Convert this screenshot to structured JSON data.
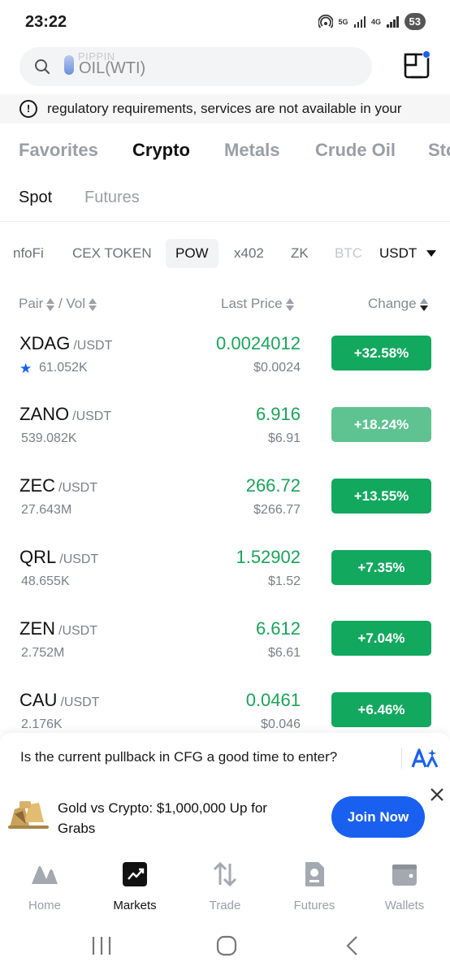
{
  "status_bar": {
    "time": "23:22",
    "net1": "5G",
    "net2": "4G",
    "battery": "53",
    "icons": [
      "hotspot-icon",
      "signal-icon",
      "battery-icon"
    ]
  },
  "search": {
    "ghost_text": "PIPPIN",
    "text": "OIL(WTI)",
    "icons": [
      "search-icon",
      "scan-icon"
    ]
  },
  "notice": {
    "icon": "!",
    "text": "regulatory requirements, services are not available in your"
  },
  "category_tabs": [
    {
      "label": "Favorites"
    },
    {
      "label": "Crypto"
    },
    {
      "label": "Metals"
    },
    {
      "label": "Crude Oil"
    },
    {
      "label": "Sto"
    }
  ],
  "category_active": "Crypto",
  "sub_tabs": [
    {
      "label": "Spot"
    },
    {
      "label": "Futures"
    }
  ],
  "filters": [
    {
      "label": "nfoFi"
    },
    {
      "label": "CEX TOKEN"
    },
    {
      "label": "POW"
    },
    {
      "label": "x402"
    },
    {
      "label": "ZK"
    },
    {
      "label": "BTC"
    }
  ],
  "filter_active": "POW",
  "quote_currency": "USDT",
  "columns": {
    "pair": "Pair",
    "sep": " / ",
    "vol": "Vol",
    "last_price": "Last Price",
    "change": "Change"
  },
  "rows": [
    {
      "base": "XDAG",
      "quote": "/USDT",
      "vol": "61.052K",
      "favorite": true,
      "price": "0.0024012",
      "fiat": "$0.0024",
      "change": "+32.58%"
    },
    {
      "base": "ZANO",
      "quote": "/USDT",
      "vol": "539.082K",
      "favorite": false,
      "price": "6.916",
      "fiat": "$6.91",
      "change": "+18.24%"
    },
    {
      "base": "ZEC",
      "quote": "/USDT",
      "vol": "27.643M",
      "favorite": false,
      "price": "266.72",
      "fiat": "$266.77",
      "change": "+13.55%"
    },
    {
      "base": "QRL",
      "quote": "/USDT",
      "vol": "48.655K",
      "favorite": false,
      "price": "1.52902",
      "fiat": "$1.52",
      "change": "+7.35%"
    },
    {
      "base": "ZEN",
      "quote": "/USDT",
      "vol": "2.752M",
      "favorite": false,
      "price": "6.612",
      "fiat": "$6.61",
      "change": "+7.04%"
    },
    {
      "base": "CAU",
      "quote": "/USDT",
      "vol": "2.176K",
      "favorite": false,
      "price": "0.0461",
      "fiat": "$0.046",
      "change": "+6.46%"
    }
  ],
  "ai_prompt": {
    "text": "Is the current pullback in CFG a good time to enter?",
    "icon": "ai-assistant-icon"
  },
  "promo": {
    "text": "Gold vs Crypto: $1,000,000 Up for Grabs",
    "button": "Join Now",
    "icons": [
      "promo-image-icon",
      "close-icon"
    ]
  },
  "bottom_nav": [
    {
      "label": "Home",
      "icon": "home-icon"
    },
    {
      "label": "Markets",
      "icon": "markets-icon"
    },
    {
      "label": "Trade",
      "icon": "trade-icon"
    },
    {
      "label": "Futures",
      "icon": "futures-icon"
    },
    {
      "label": "Wallets",
      "icon": "wallet-icon"
    }
  ],
  "nav_active": "Markets",
  "colors": {
    "positive": "#1aa35a",
    "change_bg": "#12a85e",
    "change_bg_light": "#5ec391",
    "accent": "#1960f0"
  }
}
